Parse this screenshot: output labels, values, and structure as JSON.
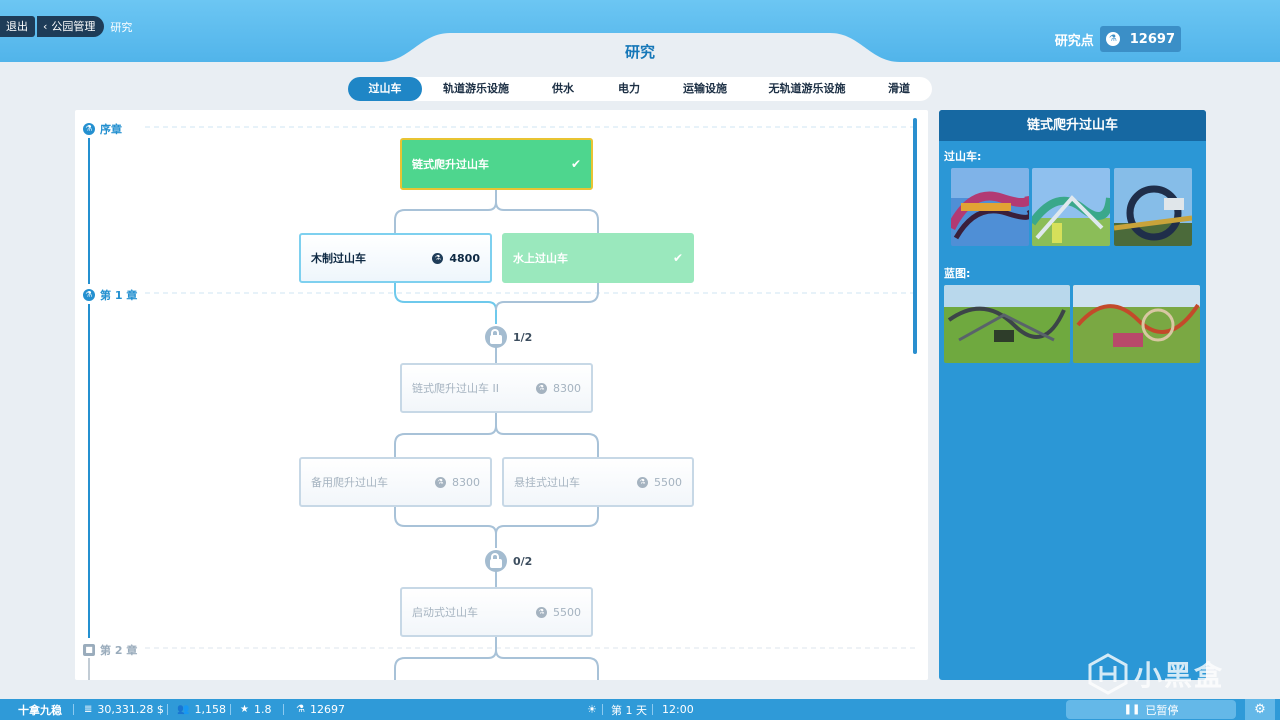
{
  "breadcrumb": {
    "exit": "退出",
    "park": "公园管理",
    "current": "研究"
  },
  "page_title": "研究",
  "research_points": {
    "label": "研究点",
    "value": "12697"
  },
  "tabs": [
    {
      "label": "过山车",
      "active": true
    },
    {
      "label": "轨道游乐设施",
      "active": false
    },
    {
      "label": "供水",
      "active": false
    },
    {
      "label": "电力",
      "active": false
    },
    {
      "label": "运输设施",
      "active": false
    },
    {
      "label": "无轨道游乐设施",
      "active": false
    },
    {
      "label": "滑道",
      "active": false
    }
  ],
  "chapters": {
    "prologue": "序章",
    "ch1": "第 1 章",
    "ch2": "第 2 章"
  },
  "nodes": {
    "chain_lift": {
      "label": "链式爬升过山车",
      "status": "researched"
    },
    "wooden": {
      "label": "木制过山车",
      "cost": "4800",
      "status": "available"
    },
    "water": {
      "label": "水上过山车",
      "status": "researched"
    },
    "chain_lift_2": {
      "label": "链式爬升过山车 II",
      "cost": "8300",
      "status": "locked"
    },
    "backup_lift": {
      "label": "备用爬升过山车",
      "cost": "8300",
      "status": "locked"
    },
    "suspended": {
      "label": "悬挂式过山车",
      "cost": "5500",
      "status": "locked"
    },
    "launched": {
      "label": "启动式过山车",
      "cost": "5500",
      "status": "locked"
    }
  },
  "locks": {
    "ch1_gate": "1/2",
    "ch1_gate2": "0/2"
  },
  "side_panel": {
    "title": "链式爬升过山车",
    "rides_label": "过山车:",
    "blueprints_label": "蓝图:"
  },
  "bottom_bar": {
    "park_name": "十拿九稳",
    "money": "30,331.28 $",
    "guests": "1,158",
    "rating": "1.8",
    "research": "12697",
    "day": "第 1 天",
    "time": "12:00",
    "pause": "已暂停"
  },
  "watermark": "小黑盒",
  "colors": {
    "accent": "#1f86c6",
    "researched": "#4ed68e",
    "panel": "#2b97d6"
  }
}
